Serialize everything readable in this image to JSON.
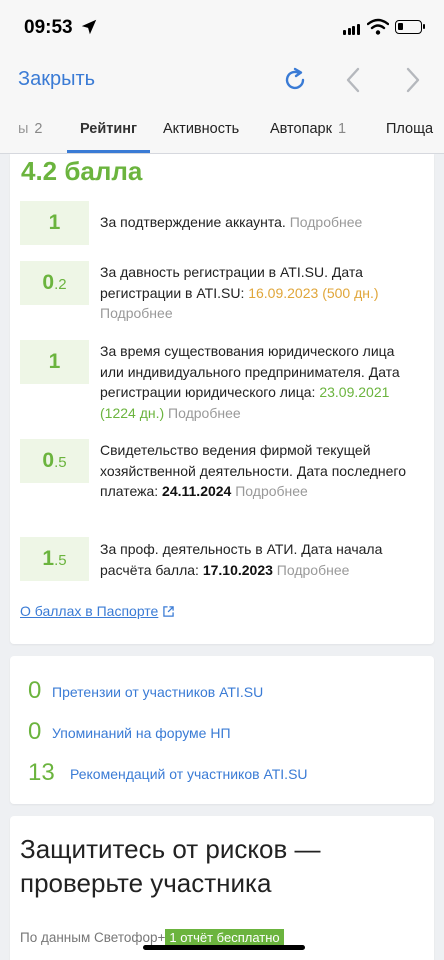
{
  "status_bar": {
    "time": "09:53"
  },
  "nav": {
    "close_label": "Закрыть"
  },
  "tabs": [
    {
      "label": "ы",
      "count": "2"
    },
    {
      "label": "Рейтинг",
      "count": ""
    },
    {
      "label": "Активность",
      "count": ""
    },
    {
      "label": "Автопарк",
      "count": "1"
    },
    {
      "label": "Площа",
      "count": ""
    }
  ],
  "rating": {
    "total": "4.2 балла",
    "items": [
      {
        "score_int": "1",
        "score_frac": "",
        "text": "За подтверждение аккаунта.",
        "more": "Подробнее"
      },
      {
        "score_int": "0",
        "score_frac": ".2",
        "text": "За давность регистрации в ATI.SU. Дата регистрации в ATI.SU:",
        "date": "16.09.2023",
        "extra": "(500 дн.)",
        "more": "Подробнее"
      },
      {
        "score_int": "1",
        "score_frac": "",
        "text": "За время существования юридического лица или индивидуального предпринимателя. Дата регистрации юридического лица:",
        "date": "23.09.2021 (1224 дн.)",
        "more": "Подробнее"
      },
      {
        "score_int": "0",
        "score_frac": ".5",
        "text": "Свидетельство ведения фирмой текущей хозяйственной деятельности. Дата последнего платежа:",
        "date": "24.11.2024",
        "more": "Подробнее"
      },
      {
        "score_int": "1",
        "score_frac": ".5",
        "text": "За проф. деятельность в АТИ. Дата начала расчёта балла:",
        "date": "17.10.2023",
        "more": "Подробнее"
      }
    ],
    "passport_link": "О баллах в Паспорте"
  },
  "stats": [
    {
      "value": "0",
      "label": "Претензии от участников ATI.SU"
    },
    {
      "value": "0",
      "label": "Упоминаний на форуме НП"
    },
    {
      "value": "13",
      "label": "Рекомендаций от участников ATI.SU"
    }
  ],
  "risk": {
    "title_line1": "Защититесь от рисков —",
    "title_line2": "проверьте участника",
    "source": "По данным Светофор+",
    "badge": "1 отчёт бесплатно"
  },
  "colors": {
    "accent_green": "#6bb43e",
    "link_blue": "#3a7bd5",
    "date_yellow": "#e0a63a"
  },
  "icons": [
    "location-arrow-icon",
    "signal-icon",
    "wifi-icon",
    "battery-icon",
    "refresh-icon",
    "chevron-left-icon",
    "chevron-right-icon",
    "external-link-icon"
  ]
}
